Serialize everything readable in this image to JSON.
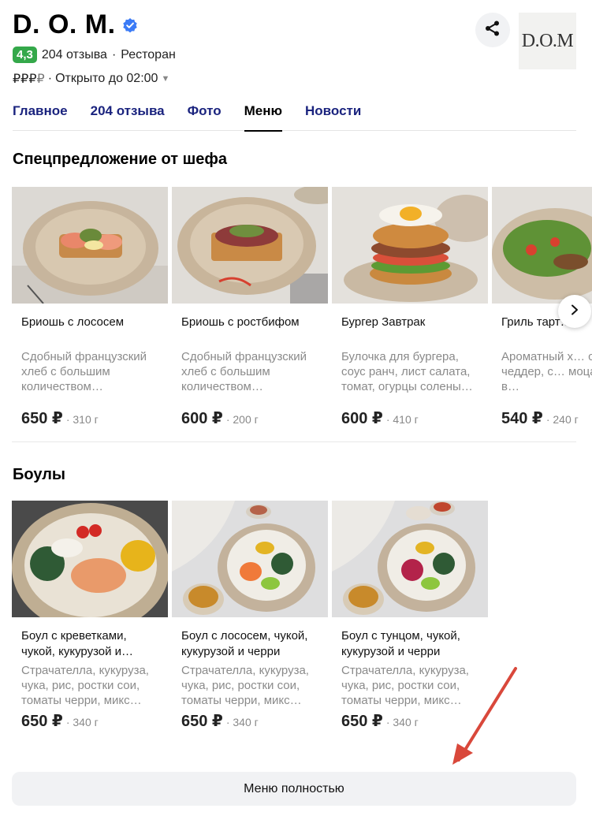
{
  "header": {
    "title": "D. O. M.",
    "rating": "4,3",
    "reviews": "204 отзыва",
    "separator": "·",
    "category": "Ресторан",
    "price_level_strong": "₽₽₽",
    "price_level_weak": "₽",
    "hours": "Открыто до 02:00",
    "logo_text": "D.O.M"
  },
  "tabs": [
    {
      "label": "Главное",
      "active": false
    },
    {
      "label": "204 отзыва",
      "active": false
    },
    {
      "label": "Фото",
      "active": false
    },
    {
      "label": "Меню",
      "active": true
    },
    {
      "label": "Новости",
      "active": false
    }
  ],
  "sections": {
    "chef": {
      "title": "Спецпредложение от шефа",
      "items": [
        {
          "name": "Бриошь с лососем",
          "desc": "Сдобный французский хлеб с большим количеством…",
          "price": "650 ₽",
          "weight": "· 310 г"
        },
        {
          "name": "Бриошь с ростбифом",
          "desc": "Сдобный французский хлеб с большим количеством…",
          "price": "600 ₽",
          "weight": "· 200 г"
        },
        {
          "name": "Бургер Завтрак",
          "desc": "Булочка для бургера, соус ранч, лист салата, томат, огурцы солены…",
          "price": "600 ₽",
          "weight": "· 410 г"
        },
        {
          "name": "Гриль тарт…",
          "desc": "Ароматный х… сыр чеддер, с… моцарелла, в…",
          "price": "540 ₽",
          "weight": "· 240 г"
        }
      ]
    },
    "bowls": {
      "title": "Боулы",
      "items": [
        {
          "name": "Боул с креветками, чукой, кукурузой и…",
          "desc": "Страчателла, кукуруза, чука, рис, ростки сои, томаты черри, микс…",
          "price": "650 ₽",
          "weight": "· 340 г"
        },
        {
          "name": "Боул с лососем, чукой, кукурузой и черри",
          "desc": "Страчателла, кукуруза, чука, рис, ростки сои, томаты черри, микс…",
          "price": "650 ₽",
          "weight": "· 340 г"
        },
        {
          "name": "Боул с тунцом, чукой, кукурузой и черри",
          "desc": "Страчателла, кукуруза, чука, рис, ростки сои, томаты черри, микс…",
          "price": "650 ₽",
          "weight": "· 340 г"
        }
      ]
    }
  },
  "full_menu_label": "Меню полностью",
  "colors": {
    "rating_bg": "#34a84a",
    "tab_link": "#1a237e",
    "verified": "#3b7bf6",
    "annotation_arrow": "#d9483b",
    "button_bg": "#f1f2f4"
  },
  "icons": {
    "verified": "verified-check-icon",
    "share": "share-icon",
    "next": "chevron-right-icon",
    "caret": "caret-down-icon"
  }
}
